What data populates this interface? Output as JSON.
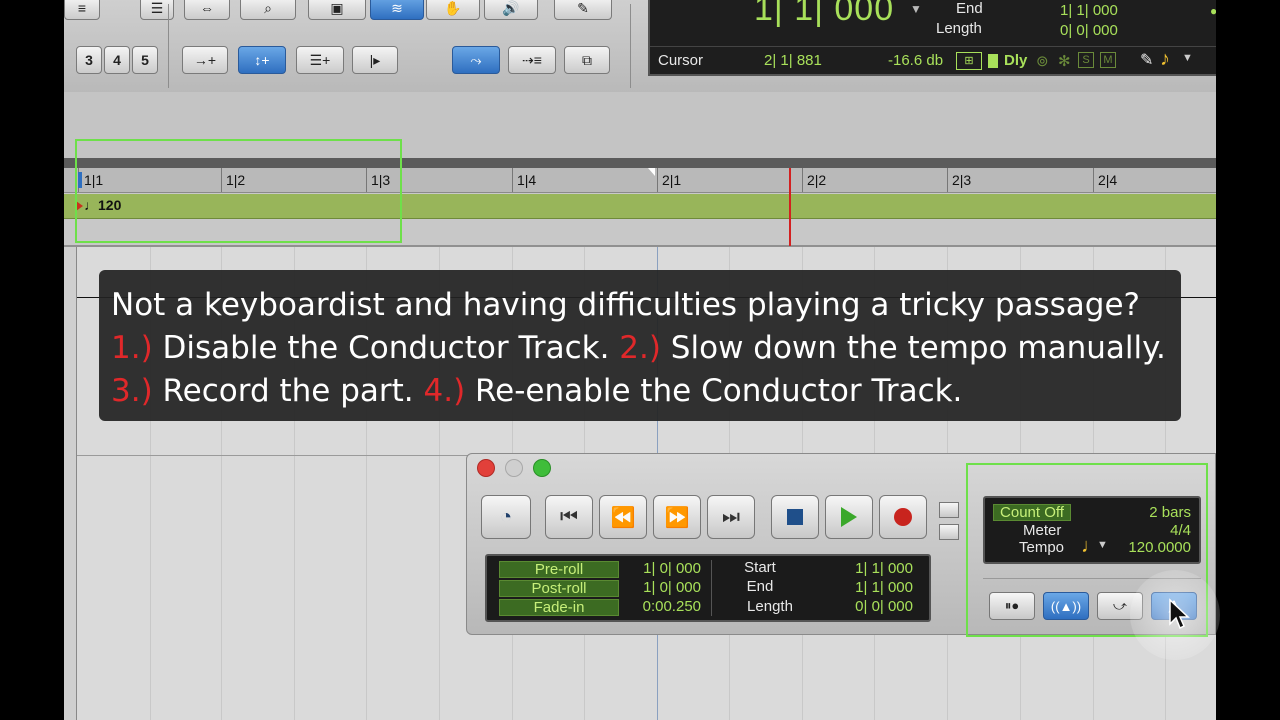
{
  "toolbar": {
    "numbers": [
      "3",
      "4",
      "5"
    ],
    "counter": {
      "main": "1| 1| 000",
      "end_label": "End",
      "end_value": "1| 1| 000",
      "length_label": "Length",
      "length_value": "0| 0| 000",
      "cursor_label": "Cursor",
      "cursor_value": "2| 1| 881",
      "level": "-16.6 db",
      "dly": "Dly",
      "s": "S",
      "m": "M"
    }
  },
  "ruler": {
    "bars": [
      "1|1",
      "1|2",
      "1|3",
      "1|4",
      "2|1",
      "2|2",
      "2|3",
      "2|4"
    ]
  },
  "tempo_lane": {
    "value": "120"
  },
  "caption": {
    "line1": "Not a keyboardist and having difficulties playing a tricky passage?",
    "step1_num": "1.)",
    "step1_text": " Disable the Conductor Track. ",
    "step2_num": "2.)",
    "step2_text": " Slow down the tempo manually.",
    "step3_num": "3.)",
    "step3_text": " Record the part. ",
    "step4_num": "4.)",
    "step4_text": " Re-enable the Conductor Track."
  },
  "transport": {
    "preroll_label": "Pre-roll",
    "preroll_value": "1| 0| 000",
    "postroll_label": "Post-roll",
    "postroll_value": "1| 0| 000",
    "fadein_label": "Fade-in",
    "fadein_value": "0:00.250",
    "start_label": "Start",
    "start_value": "1| 1| 000",
    "end_label": "End",
    "end_value": "1| 1| 000",
    "length_label": "Length",
    "length_value": "0| 0| 000",
    "countoff_label": "Count Off",
    "countoff_value": "2 bars",
    "meter_label": "Meter",
    "meter_value": "4/4",
    "tempo_label": "Tempo",
    "tempo_value": "120.0000"
  },
  "colors": {
    "highlight": "#6ee04a",
    "caption_step": "#e0282a",
    "lcd_text": "#a8e05a",
    "tempo_lane": "#98b55a"
  }
}
